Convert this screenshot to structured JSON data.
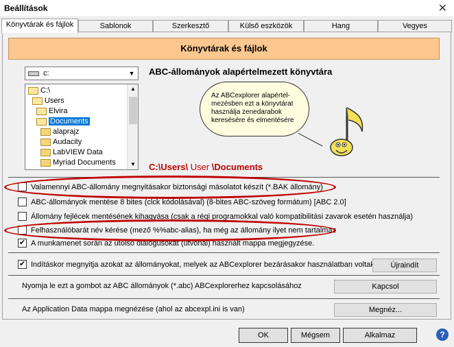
{
  "window": {
    "title": "Beállítások",
    "close_icon": "close-icon"
  },
  "tabs": [
    {
      "label": "Könyvtárak és fájlok",
      "active": true
    },
    {
      "label": "Sablonok"
    },
    {
      "label": "Szerkesztő"
    },
    {
      "label": "Külső eszközök"
    },
    {
      "label": "Hang"
    },
    {
      "label": "Vegyes"
    }
  ],
  "panel": {
    "header": "Könyvtárak és fájlok",
    "drive_combo": {
      "value": "c:"
    },
    "folders": [
      {
        "label": "C:\\"
      },
      {
        "label": "Users"
      },
      {
        "label": "Elvira"
      },
      {
        "label": "Documents",
        "selected": true
      },
      {
        "label": "alaprajz"
      },
      {
        "label": "Audacity"
      },
      {
        "label": "LabVIEW Data"
      },
      {
        "label": "Myriad Documents"
      }
    ],
    "default_dir_label": "ABC-állományok alapértelmezett könyvtára",
    "bubble_text": "Az ABCexplorer alapértel-mezésben ezt a könyvtárat használja zenedarabok keresésére és elmentésére",
    "path": {
      "prefix": "C:\\Users\\",
      "user": " User ",
      "suffix": "\\Documents"
    }
  },
  "options": [
    {
      "label": "Valamennyi ABC-állomány megnyitásakor biztonsági másolatot készít (*.BAK állomány)",
      "checked": false
    },
    {
      "label": "ABC-állományok mentése 8 bites (clck kódolásával) (8-bites ABC-szöveg formátum) [ABC 2.0]",
      "checked": false
    },
    {
      "label": "Állomány fejlécek mentésének kihagyása (csak a régi programokkal való kompatibilitási zavarok esetén használja)",
      "checked": false
    },
    {
      "label": "Felhasználóbarát név kérése (mező %%abc-alias), ha még az állomány ilyet nem tartalmaz",
      "checked": false
    },
    {
      "label": "A munkamenet során az utolsó dialógusokat (útvonal) használt mappa megjegyzése.",
      "checked": true
    }
  ],
  "startup": {
    "label": "Indításkor megnyitja azokat az állományokat, melyek az ABCexplorer bezárásakor használatban voltak",
    "checked": true,
    "button": "Újraindít"
  },
  "assoc": {
    "label": "Nyomja le ezt a gombot az ABC állományok (*.abc) ABCexplorerhez kapcsolásához",
    "button": "Kapcsol"
  },
  "appdata": {
    "label": "Az Application Data mappa megnézése (ahol az abcexpl.ini is van)",
    "button": "Megnéz..."
  },
  "footer": {
    "ok": "OK",
    "cancel": "Mégsem",
    "apply": "Alkalmaz",
    "help": "?"
  },
  "colors": {
    "header_bg": "#fcc890",
    "highlight": "#c00000",
    "selection": "#0078d7"
  }
}
